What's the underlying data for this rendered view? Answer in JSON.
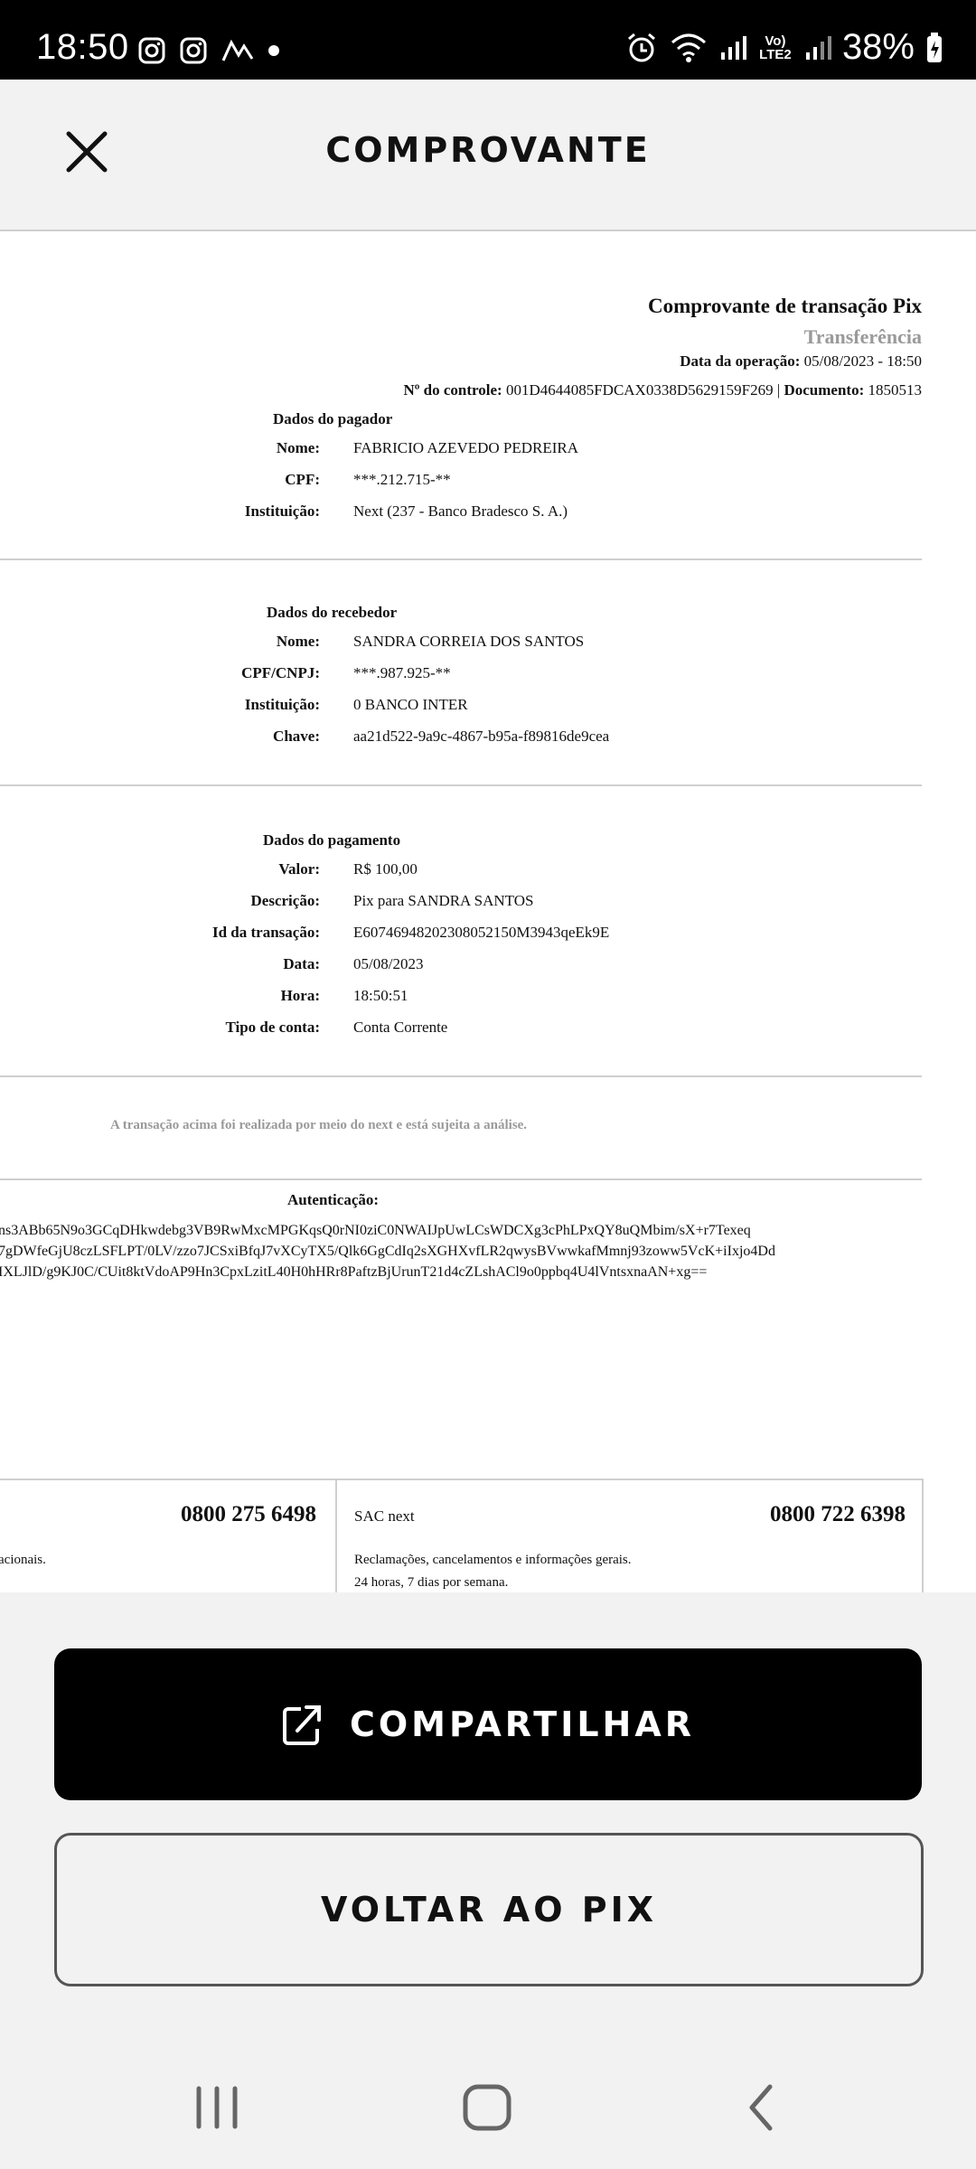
{
  "status_bar": {
    "time": "18:50",
    "battery": "38%",
    "network_label": "Vo) LTE2",
    "icons": [
      "instagram-icon",
      "instagram-icon",
      "ride-app-icon",
      "dot-icon",
      "alarm-icon",
      "wifi-icon",
      "signal-icon",
      "signal-icon",
      "battery-charging-icon"
    ]
  },
  "header": {
    "title": "COMPROVANTE",
    "close_icon": "close-icon"
  },
  "receipt": {
    "title": "Comprovante de transação Pix",
    "subtitle": "Transferência",
    "operation_date_label": "Data da operação:",
    "operation_date_value": "05/08/2023 - 18:50",
    "control_label": "Nº do controle:",
    "control_value": "001D4644085FDCAX0338D5629159F269 |",
    "document_label": "Documento:",
    "document_value": "1850513",
    "payer": {
      "title": "Dados do pagador",
      "name_label": "Nome:",
      "name": "FABRICIO AZEVEDO PEDREIRA",
      "cpf_label": "CPF:",
      "cpf": "***.212.715-**",
      "institution_label": "Instituição:",
      "institution": "Next (237 - Banco Bradesco S. A.)"
    },
    "receiver": {
      "title": "Dados do recebedor",
      "name_label": "Nome:",
      "name": "SANDRA CORREIA DOS SANTOS",
      "doc_label": "CPF/CNPJ:",
      "doc": "***.987.925-**",
      "institution_label": "Instituição:",
      "institution": "0 BANCO INTER",
      "key_label": "Chave:",
      "key": "aa21d522-9a9c-4867-b95a-f89816de9cea"
    },
    "payment": {
      "title": "Dados do pagamento",
      "value_label": "Valor:",
      "value": "R$ 100,00",
      "description_label": "Descrição:",
      "description": "Pix para SANDRA SANTOS",
      "txid_label": "Id da transação:",
      "txid": "E60746948202308052150M3943qeEk9E",
      "date_label": "Data:",
      "date": "05/08/2023",
      "time_label": "Hora:",
      "time": "18:50:51",
      "account_type_label": "Tipo de conta:",
      "account_type": "Conta Corrente"
    },
    "notice": "A transação acima foi realizada por meio do next e está sujeita a análise.",
    "auth_title": "Autenticação:",
    "auth_lines": [
      "ns3ABb65N9o3GCqDHkwdebg3VB9RwMxcMPGKqsQ0rNI0ziC0NWAIJpUwLCsWDCXg3cPhLPxQY8uQMbim/sX+r7Texeq",
      "7gDWfeGjU8czLSFLPT/0LV/zzo7JCSxiBfqJ7vXCyTX5/Qlk6GgCdIq2sXGHXvfLR2qwysBVwwkafMmnj93zoww5VcK+iIxjo4Dd",
      "IXLJlD/g9KJ0C/CUit8ktVdoAP9Hn3CpxLzitL40H0hHRr8PaftzBjUrunT21d4cZLshACl9o0ppbq4U4lVntsxnaAN+xg=="
    ],
    "footer": {
      "left_phone": "0800 275 6498",
      "left_text": "acionais.",
      "sac_label": "SAC next",
      "sac_phone": "0800 722 6398",
      "sac_text_1": "Reclamações, cancelamentos e informações gerais.",
      "sac_text_2": "24 horas, 7 dias por semana."
    }
  },
  "actions": {
    "share_label": "COMPARTILHAR",
    "share_icon": "share-icon",
    "back_label": "VOLTAR AO PIX"
  },
  "nav": {
    "recents": "recents-icon",
    "home": "home-icon",
    "back": "back-icon"
  }
}
